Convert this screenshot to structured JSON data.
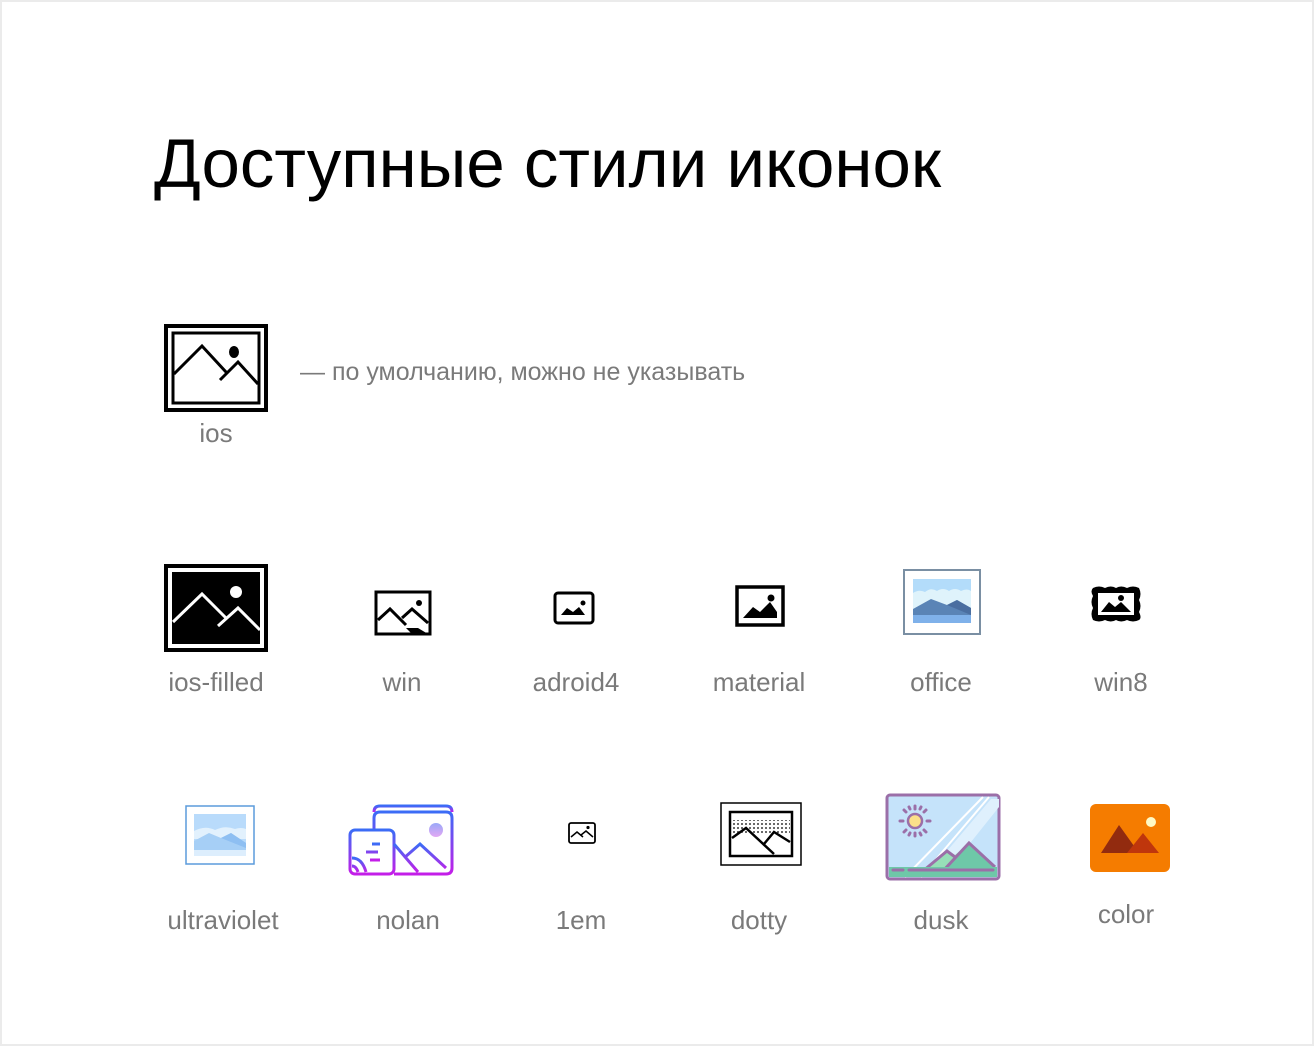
{
  "title": "Доступные стили иконок",
  "default_style": {
    "name": "ios",
    "note": "— по умолчанию, можно не указывать"
  },
  "styles": [
    {
      "name": "ios-filled",
      "icon": "image-icon-ios-filled"
    },
    {
      "name": "win",
      "icon": "image-icon-win"
    },
    {
      "name": "adroid4",
      "icon": "image-icon-android4"
    },
    {
      "name": "material",
      "icon": "image-icon-material"
    },
    {
      "name": "office",
      "icon": "image-icon-office"
    },
    {
      "name": "win8",
      "icon": "image-icon-win8"
    },
    {
      "name": "ultraviolet",
      "icon": "image-icon-ultraviolet"
    },
    {
      "name": "nolan",
      "icon": "image-icon-nolan"
    },
    {
      "name": "1em",
      "icon": "image-icon-1em"
    },
    {
      "name": "dotty",
      "icon": "image-icon-dotty"
    },
    {
      "name": "dusk",
      "icon": "image-icon-dusk"
    },
    {
      "name": "color",
      "icon": "image-icon-color"
    }
  ],
  "colors": {
    "label_gray": "#7a7a7a",
    "office_blue": "#5b86b8",
    "color_orange": "#f57c00",
    "dusk_purple": "#9b6fa8",
    "nolan_gradient_top": "#3b6cf6",
    "nolan_gradient_bottom": "#c41ee8"
  }
}
